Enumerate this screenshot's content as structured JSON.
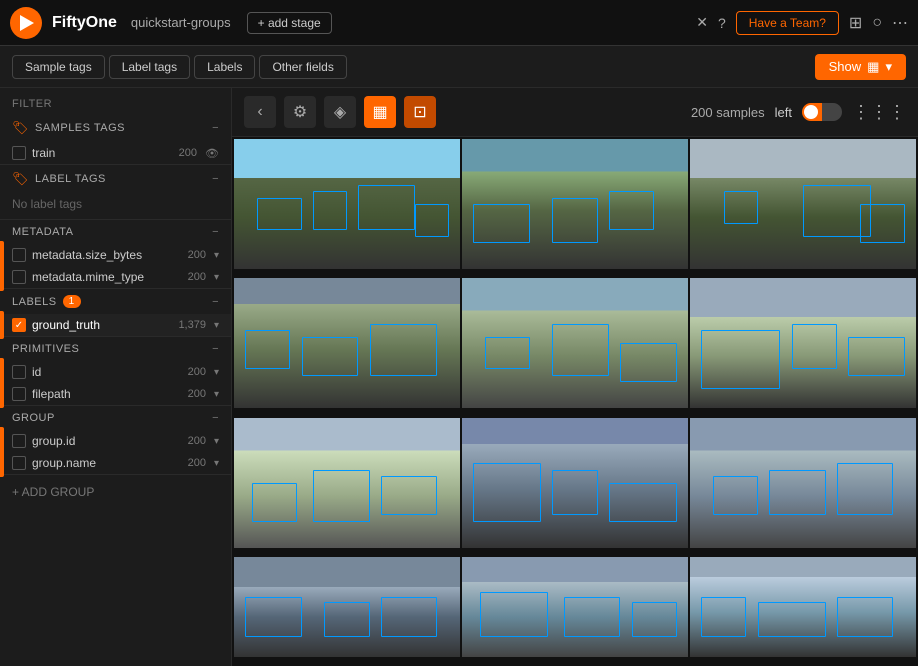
{
  "header": {
    "logo_text": "▶",
    "app_name": "FiftyOne",
    "dataset_name": "quickstart-groups",
    "add_stage_label": "+ add stage",
    "close_label": "✕",
    "help_label": "?",
    "have_team_label": "Have a Team?",
    "grid_label": "⊞",
    "github_label": "○",
    "more_label": "⋯"
  },
  "tagbar": {
    "sample_tags_label": "Sample tags",
    "label_tags_label": "Label tags",
    "labels_label": "Labels",
    "other_fields_label": "Other fields",
    "show_label": "Show"
  },
  "sidebar": {
    "filter_label": "FILTER",
    "sections": [
      {
        "id": "samples-tags",
        "header": "SAMPLES TAGS",
        "items": [
          {
            "id": "train",
            "label": "train",
            "count": "200",
            "checked": false,
            "eye": true
          }
        ]
      },
      {
        "id": "label-tags",
        "header": "LABEL TAGS",
        "items": [],
        "no_label": "No label tags"
      },
      {
        "id": "metadata",
        "header": "METADATA",
        "items": [
          {
            "id": "metadata-size",
            "label": "metadata.size_bytes",
            "count": "200",
            "checked": false
          },
          {
            "id": "metadata-mime",
            "label": "metadata.mime_type",
            "count": "200",
            "checked": false
          }
        ]
      },
      {
        "id": "labels",
        "header": "LABELS",
        "badge": "1",
        "items": [
          {
            "id": "ground-truth",
            "label": "ground_truth",
            "count": "1,379",
            "checked": true
          }
        ]
      },
      {
        "id": "primitives",
        "header": "PRIMITIVES",
        "items": [
          {
            "id": "field-id",
            "label": "id",
            "count": "200",
            "checked": false
          },
          {
            "id": "field-filepath",
            "label": "filepath",
            "count": "200",
            "checked": false
          }
        ]
      },
      {
        "id": "group",
        "header": "GROUP",
        "items": [
          {
            "id": "group-id",
            "label": "group.id",
            "count": "200",
            "checked": false
          },
          {
            "id": "group-name",
            "label": "group.name",
            "count": "200",
            "checked": false
          }
        ]
      }
    ],
    "add_group_label": "+ ADD GROUP"
  },
  "content": {
    "toolbar": {
      "back_label": "‹",
      "settings_label": "⚙",
      "tag_label": "◈",
      "grid_label": "▦",
      "bookmark_label": "⊡"
    },
    "samples_count": "200 samples",
    "view_label": "left",
    "grid_icon_label": "⋮⋮⋮"
  }
}
